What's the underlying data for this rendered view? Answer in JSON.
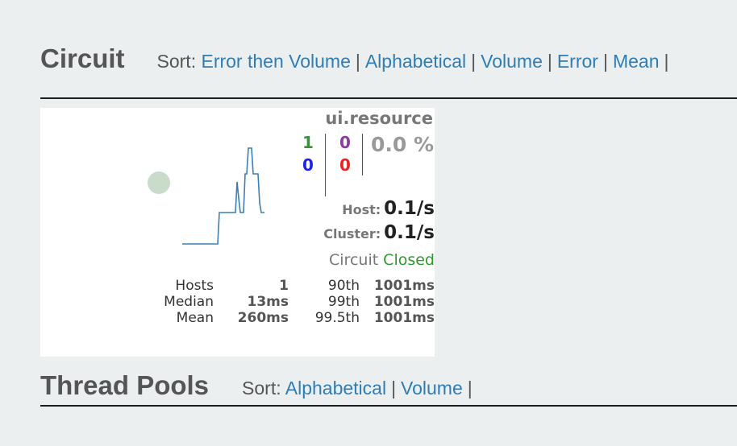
{
  "circuit": {
    "title": "Circuit",
    "sort_label": "Sort:",
    "sort_options": [
      "Error then Volume",
      "Alphabetical",
      "Volume",
      "Error",
      "Mean"
    ],
    "card": {
      "name": "ui.resource",
      "counts": {
        "success": "1",
        "short_circuited": "0",
        "timeout": "0",
        "failure": "0"
      },
      "error_percentage": "0.0 %",
      "host_label": "Host:",
      "host_rate": "0.1/s",
      "cluster_label": "Cluster:",
      "cluster_rate": "0.1/s",
      "circuit_label": "Circuit",
      "circuit_status": "Closed",
      "stats": {
        "hosts_label": "Hosts",
        "hosts_value": "1",
        "median_label": "Median",
        "median_value": "13ms",
        "mean_label": "Mean",
        "mean_value": "260ms",
        "p90_label": "90th",
        "p90_value": "1001ms",
        "p99_label": "99th",
        "p99_value": "1001ms",
        "p995_label": "99.5th",
        "p995_value": "1001ms"
      },
      "colors": {
        "success": "#2e9a2e",
        "short_circuited": "#8e3aa0",
        "timeout": "#2222ee",
        "failure": "#ee2222",
        "status_closed": "#2e9a2e",
        "health_circle": "#c9dcc9",
        "sparkline": "#3b7fb5"
      }
    }
  },
  "thread_pools": {
    "title": "Thread Pools",
    "sort_label": "Sort:",
    "sort_options": [
      "Alphabetical",
      "Volume"
    ]
  }
}
